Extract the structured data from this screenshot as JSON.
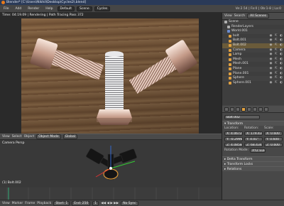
{
  "window": {
    "title": "Blender* [C:\\Users\\Nikhil\\Desktop\\Cycles2\\.blend]"
  },
  "menu": {
    "items": [
      "File",
      "Add",
      "Render",
      "Help"
    ],
    "layout": "Default",
    "scene": "Scene",
    "engine": "Cycles",
    "info": "Ve:2.54 | Fa:0 | Ob:1-8 | La:0"
  },
  "render_view": {
    "status": "Time: 04:19.09 | Rendering | Path Tracing Pass 372",
    "header": {
      "view": "View",
      "select": "Select",
      "object": "Object",
      "mode": "Object Mode",
      "orientation": "Global"
    }
  },
  "viewport3d": {
    "label": "Camera Persp",
    "selected_object": "(1) Bolt.002",
    "header": {
      "view": "View",
      "select": "Select",
      "object": "Object",
      "mode": "Object Mode",
      "orientation": "Global"
    }
  },
  "timeline": {
    "view": "View",
    "marker": "Marker",
    "frame": "Frame",
    "playback": "Playback",
    "start": "Start: 1",
    "end": "End: 250",
    "current": "1",
    "sync": "No Sync"
  },
  "outliner": {
    "view": "View",
    "search": "Search",
    "filter": "All Scenes",
    "items": [
      {
        "name": "Scene",
        "color": "#b0b0b0"
      },
      {
        "name": "RenderLayers",
        "color": "#b0b0b0"
      },
      {
        "name": "World.001",
        "color": "#6a8bd0"
      },
      {
        "name": "bolt",
        "color": "#e0a040"
      },
      {
        "name": "Bolt.001",
        "color": "#e0a040"
      },
      {
        "name": "Bolt.002",
        "color": "#e0a040"
      },
      {
        "name": "Camera",
        "color": "#e0a040"
      },
      {
        "name": "Lamp",
        "color": "#e0a040"
      },
      {
        "name": "Mesh",
        "color": "#e0a040"
      },
      {
        "name": "Mesh.001",
        "color": "#e0a040"
      },
      {
        "name": "Plane",
        "color": "#e0a040"
      },
      {
        "name": "Plane.001",
        "color": "#e0a040"
      },
      {
        "name": "Sphere",
        "color": "#e0a040"
      },
      {
        "name": "Sphere.001",
        "color": "#e0a040"
      }
    ]
  },
  "properties": {
    "object_name": "Bolt.002",
    "transform": {
      "title": "Transform",
      "location_label": "Location:",
      "rotation_label": "Rotation:",
      "scale_label": "Scale:",
      "location": [
        "X: 4.0672",
        "Y: -0.2996",
        "Z: 4.0858"
      ],
      "rotation": [
        "X: 179.43°",
        "Y: 4.01°",
        "Z: 68.434°"
      ],
      "scale": [
        "X: 0.600",
        "Y: 0.600",
        "Z: 0.600"
      ],
      "rotation_mode_label": "Rotation Mode:",
      "rotation_mode": "XYZ Euler"
    },
    "panels": [
      "Delta Transform",
      "Transform Locks",
      "Relations"
    ]
  },
  "colors": {
    "accent": "#e87a1a",
    "selection": "#f0a030",
    "x_axis": "#d33",
    "y_axis": "#3c3"
  }
}
